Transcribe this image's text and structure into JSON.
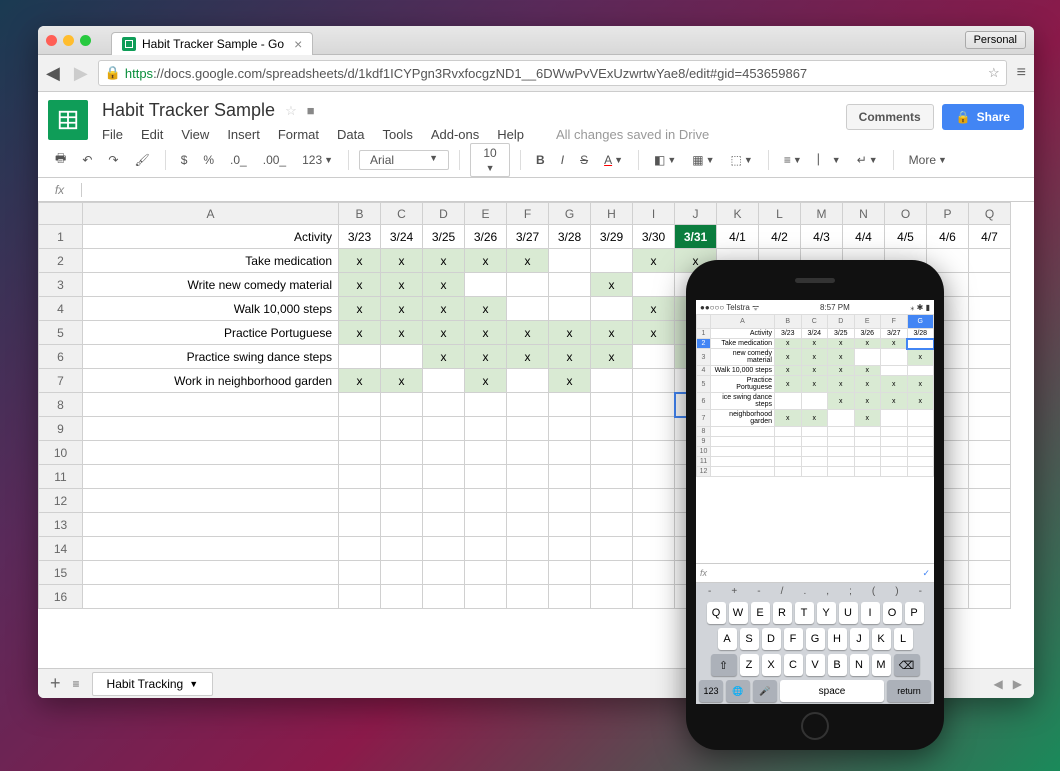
{
  "browser": {
    "tab_title": "Habit Tracker Sample - Go",
    "personal_btn": "Personal",
    "url_https": "https",
    "url_rest": "://docs.google.com/spreadsheets/d/1kdf1ICYPgn3RvxfocgzND1__6DWwPvVExUzwrtwYae8/edit#gid=453659867"
  },
  "docs": {
    "title": "Habit Tracker Sample",
    "menus": [
      "File",
      "Edit",
      "View",
      "Insert",
      "Format",
      "Data",
      "Tools",
      "Add-ons",
      "Help"
    ],
    "save_status": "All changes saved in Drive",
    "comments_btn": "Comments",
    "share_btn": "Share"
  },
  "toolbar": {
    "font": "Arial",
    "size": "10",
    "more": "More"
  },
  "sheet": {
    "fx": "fx",
    "columns": [
      "A",
      "B",
      "C",
      "D",
      "E",
      "F",
      "G",
      "H",
      "I",
      "J",
      "K",
      "L",
      "M",
      "N",
      "O",
      "P",
      "Q"
    ],
    "row_nums": [
      1,
      2,
      3,
      4,
      5,
      6,
      7,
      8,
      9,
      10,
      11,
      12,
      13,
      14,
      15,
      16
    ],
    "header_row": [
      "Activity",
      "3/23",
      "3/24",
      "3/25",
      "3/26",
      "3/27",
      "3/28",
      "3/29",
      "3/30",
      "3/31",
      "4/1",
      "4/2",
      "4/3",
      "4/4",
      "4/5",
      "4/6",
      "4/7"
    ],
    "today_col_index": 9,
    "selected_cell": {
      "row": 8,
      "col": 9
    },
    "rows": [
      {
        "activity": "Take medication",
        "marks": [
          "x",
          "x",
          "x",
          "x",
          "x",
          "",
          "",
          "x",
          "x"
        ]
      },
      {
        "activity": "Write new comedy material",
        "marks": [
          "x",
          "x",
          "x",
          "",
          "",
          "",
          "x",
          "",
          ""
        ]
      },
      {
        "activity": "Walk 10,000 steps",
        "marks": [
          "x",
          "x",
          "x",
          "x",
          "",
          "",
          "",
          "x",
          "x"
        ]
      },
      {
        "activity": "Practice Portuguese",
        "marks": [
          "x",
          "x",
          "x",
          "x",
          "x",
          "x",
          "x",
          "x",
          "x"
        ]
      },
      {
        "activity": "Practice swing dance steps",
        "marks": [
          "",
          "",
          "x",
          "x",
          "x",
          "x",
          "x",
          "",
          "x"
        ]
      },
      {
        "activity": "Work in neighborhood garden",
        "marks": [
          "x",
          "x",
          "",
          "x",
          "",
          "x",
          "",
          "",
          ""
        ]
      }
    ],
    "tab_name": "Habit Tracking"
  },
  "phone": {
    "carrier": "Telstra",
    "time": "8:57 PM",
    "columns": [
      "A",
      "B",
      "C",
      "D",
      "E",
      "F",
      "G"
    ],
    "header_row": [
      "Activity",
      "3/23",
      "3/24",
      "3/25",
      "3/26",
      "3/27",
      "3/28"
    ],
    "selected_col_index": 6,
    "selected_row_index": 1,
    "rows": [
      {
        "activity": "Take medication",
        "marks": [
          "x",
          "x",
          "x",
          "x",
          "x",
          ""
        ]
      },
      {
        "activity": "new comedy material",
        "marks": [
          "x",
          "x",
          "x",
          "",
          "",
          "x"
        ]
      },
      {
        "activity": "Walk 10,000 steps",
        "marks": [
          "x",
          "x",
          "x",
          "x",
          "",
          ""
        ]
      },
      {
        "activity": "Practice Portuguese",
        "marks": [
          "x",
          "x",
          "x",
          "x",
          "x",
          "x"
        ]
      },
      {
        "activity": "ice swing dance steps",
        "marks": [
          "",
          "",
          "x",
          "x",
          "x",
          "x"
        ]
      },
      {
        "activity": "neighborhood garden",
        "marks": [
          "x",
          "x",
          "",
          "x",
          "",
          ""
        ]
      }
    ],
    "fx": "fx",
    "keyboard": {
      "symbols": [
        "-",
        "+",
        "-",
        "/",
        ".",
        ",",
        ";",
        "(",
        ")",
        "-"
      ],
      "row1": [
        "Q",
        "W",
        "E",
        "R",
        "T",
        "Y",
        "U",
        "I",
        "O",
        "P"
      ],
      "row2": [
        "A",
        "S",
        "D",
        "F",
        "G",
        "H",
        "J",
        "K",
        "L"
      ],
      "row3": [
        "Z",
        "X",
        "C",
        "V",
        "B",
        "N",
        "M"
      ],
      "mod_123": "123",
      "space": "space",
      "return": "return"
    }
  }
}
